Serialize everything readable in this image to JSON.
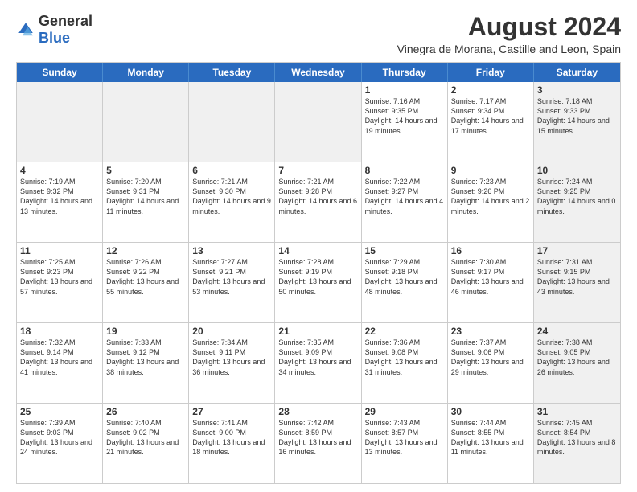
{
  "logo": {
    "general": "General",
    "blue": "Blue"
  },
  "title": {
    "month_year": "August 2024",
    "location": "Vinegra de Morana, Castille and Leon, Spain"
  },
  "days_of_week": [
    "Sunday",
    "Monday",
    "Tuesday",
    "Wednesday",
    "Thursday",
    "Friday",
    "Saturday"
  ],
  "weeks": [
    [
      {
        "day": "",
        "info": "",
        "shaded": true
      },
      {
        "day": "",
        "info": "",
        "shaded": true
      },
      {
        "day": "",
        "info": "",
        "shaded": true
      },
      {
        "day": "",
        "info": "",
        "shaded": true
      },
      {
        "day": "1",
        "info": "Sunrise: 7:16 AM\nSunset: 9:35 PM\nDaylight: 14 hours and 19 minutes.",
        "shaded": false
      },
      {
        "day": "2",
        "info": "Sunrise: 7:17 AM\nSunset: 9:34 PM\nDaylight: 14 hours and 17 minutes.",
        "shaded": false
      },
      {
        "day": "3",
        "info": "Sunrise: 7:18 AM\nSunset: 9:33 PM\nDaylight: 14 hours and 15 minutes.",
        "shaded": true
      }
    ],
    [
      {
        "day": "4",
        "info": "Sunrise: 7:19 AM\nSunset: 9:32 PM\nDaylight: 14 hours and 13 minutes.",
        "shaded": false
      },
      {
        "day": "5",
        "info": "Sunrise: 7:20 AM\nSunset: 9:31 PM\nDaylight: 14 hours and 11 minutes.",
        "shaded": false
      },
      {
        "day": "6",
        "info": "Sunrise: 7:21 AM\nSunset: 9:30 PM\nDaylight: 14 hours and 9 minutes.",
        "shaded": false
      },
      {
        "day": "7",
        "info": "Sunrise: 7:21 AM\nSunset: 9:28 PM\nDaylight: 14 hours and 6 minutes.",
        "shaded": false
      },
      {
        "day": "8",
        "info": "Sunrise: 7:22 AM\nSunset: 9:27 PM\nDaylight: 14 hours and 4 minutes.",
        "shaded": false
      },
      {
        "day": "9",
        "info": "Sunrise: 7:23 AM\nSunset: 9:26 PM\nDaylight: 14 hours and 2 minutes.",
        "shaded": false
      },
      {
        "day": "10",
        "info": "Sunrise: 7:24 AM\nSunset: 9:25 PM\nDaylight: 14 hours and 0 minutes.",
        "shaded": true
      }
    ],
    [
      {
        "day": "11",
        "info": "Sunrise: 7:25 AM\nSunset: 9:23 PM\nDaylight: 13 hours and 57 minutes.",
        "shaded": false
      },
      {
        "day": "12",
        "info": "Sunrise: 7:26 AM\nSunset: 9:22 PM\nDaylight: 13 hours and 55 minutes.",
        "shaded": false
      },
      {
        "day": "13",
        "info": "Sunrise: 7:27 AM\nSunset: 9:21 PM\nDaylight: 13 hours and 53 minutes.",
        "shaded": false
      },
      {
        "day": "14",
        "info": "Sunrise: 7:28 AM\nSunset: 9:19 PM\nDaylight: 13 hours and 50 minutes.",
        "shaded": false
      },
      {
        "day": "15",
        "info": "Sunrise: 7:29 AM\nSunset: 9:18 PM\nDaylight: 13 hours and 48 minutes.",
        "shaded": false
      },
      {
        "day": "16",
        "info": "Sunrise: 7:30 AM\nSunset: 9:17 PM\nDaylight: 13 hours and 46 minutes.",
        "shaded": false
      },
      {
        "day": "17",
        "info": "Sunrise: 7:31 AM\nSunset: 9:15 PM\nDaylight: 13 hours and 43 minutes.",
        "shaded": true
      }
    ],
    [
      {
        "day": "18",
        "info": "Sunrise: 7:32 AM\nSunset: 9:14 PM\nDaylight: 13 hours and 41 minutes.",
        "shaded": false
      },
      {
        "day": "19",
        "info": "Sunrise: 7:33 AM\nSunset: 9:12 PM\nDaylight: 13 hours and 38 minutes.",
        "shaded": false
      },
      {
        "day": "20",
        "info": "Sunrise: 7:34 AM\nSunset: 9:11 PM\nDaylight: 13 hours and 36 minutes.",
        "shaded": false
      },
      {
        "day": "21",
        "info": "Sunrise: 7:35 AM\nSunset: 9:09 PM\nDaylight: 13 hours and 34 minutes.",
        "shaded": false
      },
      {
        "day": "22",
        "info": "Sunrise: 7:36 AM\nSunset: 9:08 PM\nDaylight: 13 hours and 31 minutes.",
        "shaded": false
      },
      {
        "day": "23",
        "info": "Sunrise: 7:37 AM\nSunset: 9:06 PM\nDaylight: 13 hours and 29 minutes.",
        "shaded": false
      },
      {
        "day": "24",
        "info": "Sunrise: 7:38 AM\nSunset: 9:05 PM\nDaylight: 13 hours and 26 minutes.",
        "shaded": true
      }
    ],
    [
      {
        "day": "25",
        "info": "Sunrise: 7:39 AM\nSunset: 9:03 PM\nDaylight: 13 hours and 24 minutes.",
        "shaded": false
      },
      {
        "day": "26",
        "info": "Sunrise: 7:40 AM\nSunset: 9:02 PM\nDaylight: 13 hours and 21 minutes.",
        "shaded": false
      },
      {
        "day": "27",
        "info": "Sunrise: 7:41 AM\nSunset: 9:00 PM\nDaylight: 13 hours and 18 minutes.",
        "shaded": false
      },
      {
        "day": "28",
        "info": "Sunrise: 7:42 AM\nSunset: 8:59 PM\nDaylight: 13 hours and 16 minutes.",
        "shaded": false
      },
      {
        "day": "29",
        "info": "Sunrise: 7:43 AM\nSunset: 8:57 PM\nDaylight: 13 hours and 13 minutes.",
        "shaded": false
      },
      {
        "day": "30",
        "info": "Sunrise: 7:44 AM\nSunset: 8:55 PM\nDaylight: 13 hours and 11 minutes.",
        "shaded": false
      },
      {
        "day": "31",
        "info": "Sunrise: 7:45 AM\nSunset: 8:54 PM\nDaylight: 13 hours and 8 minutes.",
        "shaded": true
      }
    ]
  ]
}
